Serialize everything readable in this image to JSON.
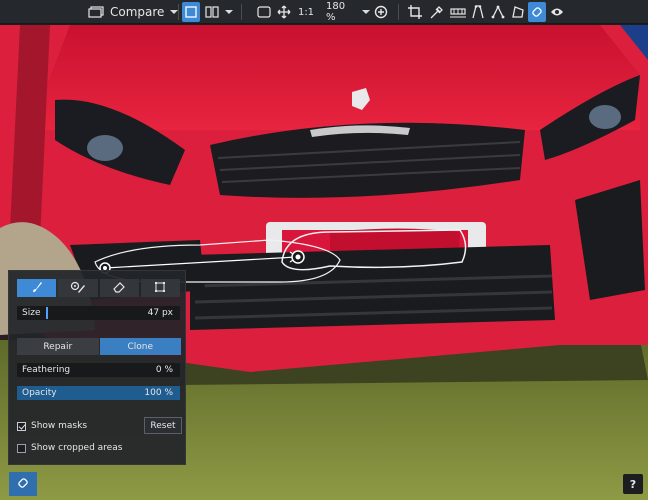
{
  "toolbar": {
    "compare_label": "Compare",
    "actual_size_label": "1:1",
    "zoom_value": "180 %",
    "icons": [
      "compare-icon",
      "single-view-icon",
      "split-view-icon",
      "fit-screen-icon",
      "pan-icon",
      "zoom-in-icon",
      "crop-icon",
      "eyedropper-icon",
      "horizon-icon",
      "perspective-icon",
      "distortion-icon",
      "freeform-icon",
      "retouch-icon",
      "preview-eye-icon"
    ]
  },
  "panel": {
    "tools": [
      "brush-icon",
      "spot-heal-icon",
      "eraser-icon",
      "selection-icon"
    ],
    "size": {
      "label": "Size",
      "value": "47 px"
    },
    "modes": {
      "repair": "Repair",
      "clone": "Clone",
      "selected": "Clone"
    },
    "feathering": {
      "label": "Feathering",
      "value": "0 %",
      "fraction": 0
    },
    "opacity": {
      "label": "Opacity",
      "value": "100 %",
      "fraction": 1
    },
    "show_masks": {
      "label": "Show masks",
      "checked": true
    },
    "show_cropped": {
      "label": "Show cropped areas",
      "checked": false
    },
    "reset_label": "Reset"
  },
  "footer": {
    "help_label": "?"
  },
  "colors": {
    "accent": "#3f8ad6",
    "car": "#e0223f",
    "grass": "#7a8a3a",
    "panel": "#222529"
  }
}
